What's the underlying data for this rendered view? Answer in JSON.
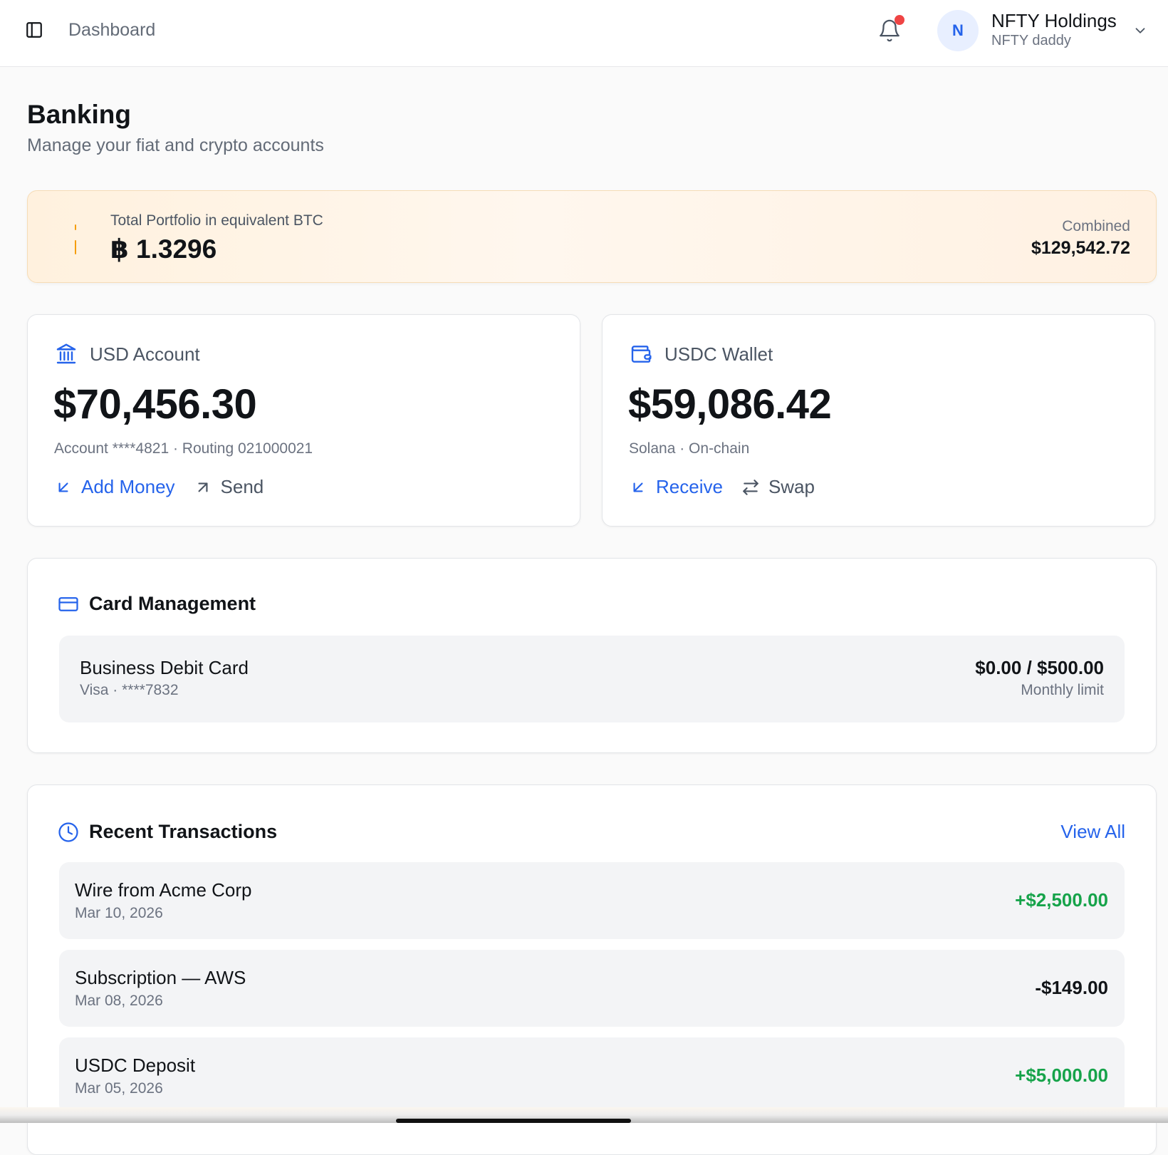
{
  "header": {
    "breadcrumb": "Dashboard",
    "avatar_initial": "N",
    "org_name": "NFTY Holdings",
    "org_subtitle": "NFTY daddy"
  },
  "page": {
    "title": "Banking",
    "subtitle": "Manage your fiat and crypto accounts"
  },
  "portfolio": {
    "label": "Total Portfolio in equivalent BTC",
    "value": "฿ 1.3296",
    "combined_label": "Combined",
    "combined_value": "$129,542.72"
  },
  "accounts": [
    {
      "title": "USD Account",
      "icon": "bank-icon",
      "balance": "$70,456.30",
      "meta": "Account ****4821 · Routing 021000021",
      "primary_action": "Add Money",
      "secondary_action": "Send"
    },
    {
      "title": "USDC Wallet",
      "icon": "wallet-icon",
      "balance": "$59,086.42",
      "meta": "Solana · On-chain",
      "primary_action": "Receive",
      "secondary_action": "Swap"
    }
  ],
  "card_management": {
    "title": "Card Management",
    "card_name": "Business Debit Card",
    "card_sub": "Visa · ****7832",
    "limit": "$0.00 / $500.00",
    "limit_label": "Monthly limit"
  },
  "transactions": {
    "title": "Recent Transactions",
    "view_all": "View All",
    "items": [
      {
        "name": "Wire from Acme Corp",
        "date": "Mar 10, 2026",
        "amount": "+$2,500.00",
        "direction": "in"
      },
      {
        "name": "Subscription — AWS",
        "date": "Mar 08, 2026",
        "amount": "-$149.00",
        "direction": "out"
      },
      {
        "name": "USDC Deposit",
        "date": "Mar 05, 2026",
        "amount": "+$5,000.00",
        "direction": "in"
      }
    ]
  },
  "colors": {
    "accent": "#2563eb",
    "positive": "#16a34a",
    "notification": "#ef4444",
    "portfolio_bg": "#fff4e6"
  }
}
